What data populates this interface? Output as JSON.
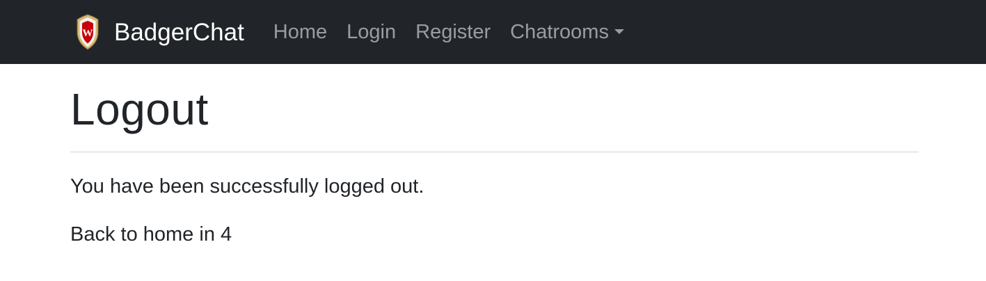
{
  "navbar": {
    "brand": {
      "logo_icon": "uw-crest-icon",
      "logo_letter": "W",
      "text": "BadgerChat"
    },
    "links": [
      {
        "label": "Home"
      },
      {
        "label": "Login"
      },
      {
        "label": "Register"
      },
      {
        "label": "Chatrooms"
      }
    ],
    "dropdown_icon": "caret-down-icon",
    "colors": {
      "background": "#212529",
      "brand_text": "#ffffff",
      "link_text": "rgba(255,255,255,0.55)",
      "crest_red": "#c5050c",
      "crest_gold": "#d4b879"
    }
  },
  "main": {
    "title": "Logout",
    "message": "You have been successfully logged out.",
    "countdown_prefix": "Back to home in",
    "countdown_value": "4"
  }
}
